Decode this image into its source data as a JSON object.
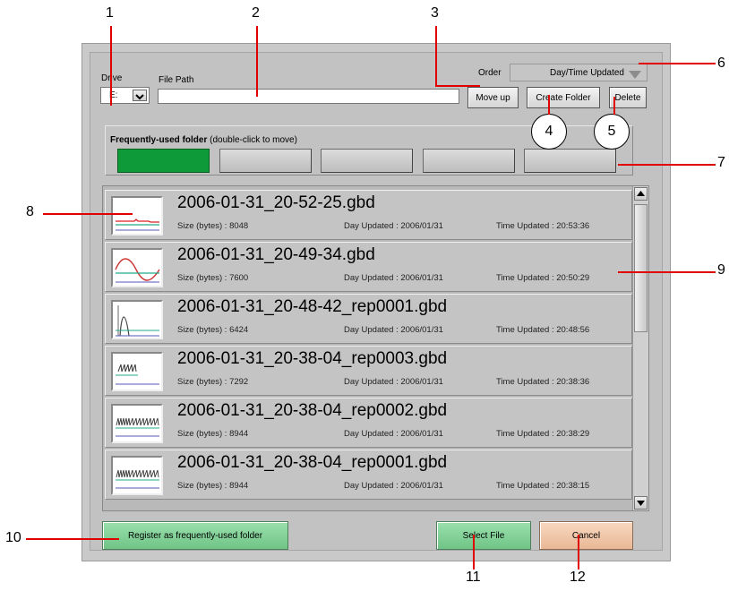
{
  "callouts": {
    "c1": "1",
    "c2": "2",
    "c3": "3",
    "c4": "4",
    "c5": "5",
    "c6": "6",
    "c7": "7",
    "c8": "8",
    "c9": "9",
    "c10": "10",
    "c11": "11",
    "c12": "12"
  },
  "header": {
    "drive_label": "Drive",
    "drive_value": "E:",
    "file_path_label": "File Path",
    "file_path_value": "",
    "order_label": "Order",
    "order_value": "Day/Time Updated",
    "move_up": "Move up",
    "create_folder": "Create Folder",
    "delete": "Delete"
  },
  "frequent": {
    "title": "Frequently-used folder",
    "hint": "(double-click to move)",
    "slots": [
      {
        "active": true
      },
      {
        "active": false
      },
      {
        "active": false
      },
      {
        "active": false
      },
      {
        "active": false
      }
    ]
  },
  "files": [
    {
      "name": "2006-01-31_20-52-25.gbd",
      "size_label": "Size (bytes) : 8048",
      "day_label": "Day Updated : 2006/01/31",
      "time_label": "Time Updated : 20:53:36",
      "thumb": "flat-icon"
    },
    {
      "name": "2006-01-31_20-49-34.gbd",
      "size_label": "Size (bytes) : 7600",
      "day_label": "Day Updated : 2006/01/31",
      "time_label": "Time Updated : 20:50:29",
      "thumb": "sine-icon"
    },
    {
      "name": "2006-01-31_20-48-42_rep0001.gbd",
      "size_label": "Size (bytes) : 6424",
      "day_label": "Day Updated : 2006/01/31",
      "time_label": "Time Updated : 20:48:56",
      "thumb": "pulse-icon"
    },
    {
      "name": "2006-01-31_20-38-04_rep0003.gbd",
      "size_label": "Size (bytes) : 7292",
      "day_label": "Day Updated : 2006/01/31",
      "time_label": "Time Updated : 20:38:36",
      "thumb": "spikes-short-icon"
    },
    {
      "name": "2006-01-31_20-38-04_rep0002.gbd",
      "size_label": "Size (bytes) : 8944",
      "day_label": "Day Updated : 2006/01/31",
      "time_label": "Time Updated : 20:38:29",
      "thumb": "spikes-icon"
    },
    {
      "name": "2006-01-31_20-38-04_rep0001.gbd",
      "size_label": "Size (bytes) : 8944",
      "day_label": "Day Updated : 2006/01/31",
      "time_label": "Time Updated : 20:38:15",
      "thumb": "spikes-icon"
    }
  ],
  "footer": {
    "register": "Register as frequently-used folder",
    "select": "Select File",
    "cancel": "Cancel"
  },
  "colors": {
    "annotation_red": "#e00000",
    "green_button": "#7ecf94",
    "cancel_button": "#f1c7a8",
    "active_slot": "#0f9a3a"
  }
}
